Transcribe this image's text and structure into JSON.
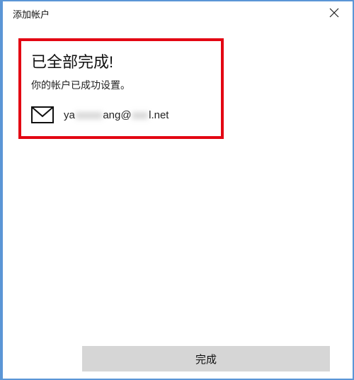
{
  "titlebar": {
    "title": "添加帐户"
  },
  "content": {
    "heading": "已全部完成!",
    "subtext": "你的帐户已成功设置。",
    "email": {
      "prefix": "ya",
      "blur1": "xxxxx",
      "mid": "ang@",
      "blur2": "xxx",
      "suffix": "l.net"
    }
  },
  "footer": {
    "done_label": "完成"
  }
}
